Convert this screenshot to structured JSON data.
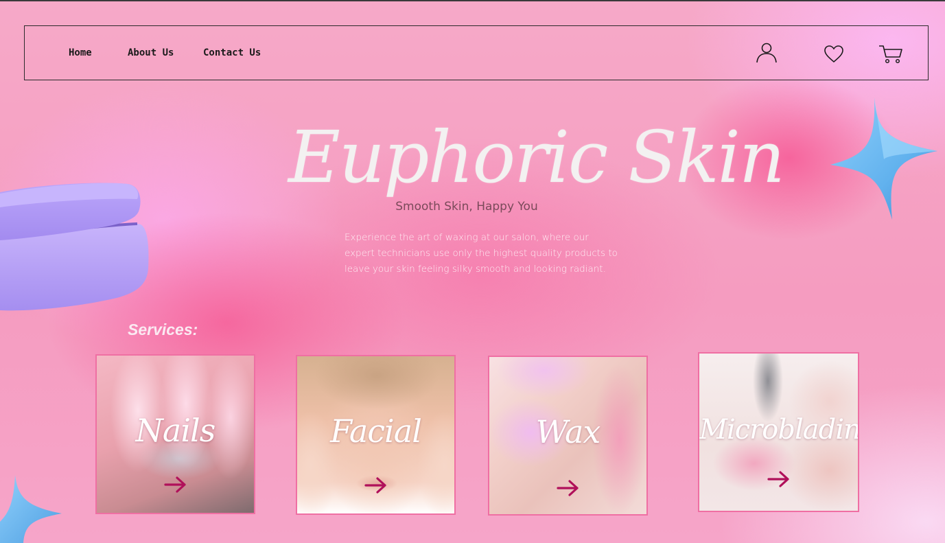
{
  "nav": {
    "links": [
      {
        "label": "Home"
      },
      {
        "label": "About Us"
      },
      {
        "label": "Contact Us"
      }
    ],
    "icons": [
      "user-icon",
      "heart-icon",
      "cart-icon"
    ]
  },
  "hero": {
    "title": "Euphoric Skin",
    "subtitle": "Smooth Skin, Happy You",
    "description": "Experience the art of waxing at our salon, where our expert technicians use only the highest quality products to leave your skin feeling silky smooth and looking radiant."
  },
  "services": {
    "heading": "Services:",
    "items": [
      {
        "label": "Nails"
      },
      {
        "label": "Facial"
      },
      {
        "label": "Wax"
      },
      {
        "label": "Microblading"
      }
    ]
  },
  "colors": {
    "accent": "#b0105a",
    "card_border": "#ef6fa3",
    "star_blue": "#6fbcf2",
    "jar_purple": "#b49af5"
  }
}
